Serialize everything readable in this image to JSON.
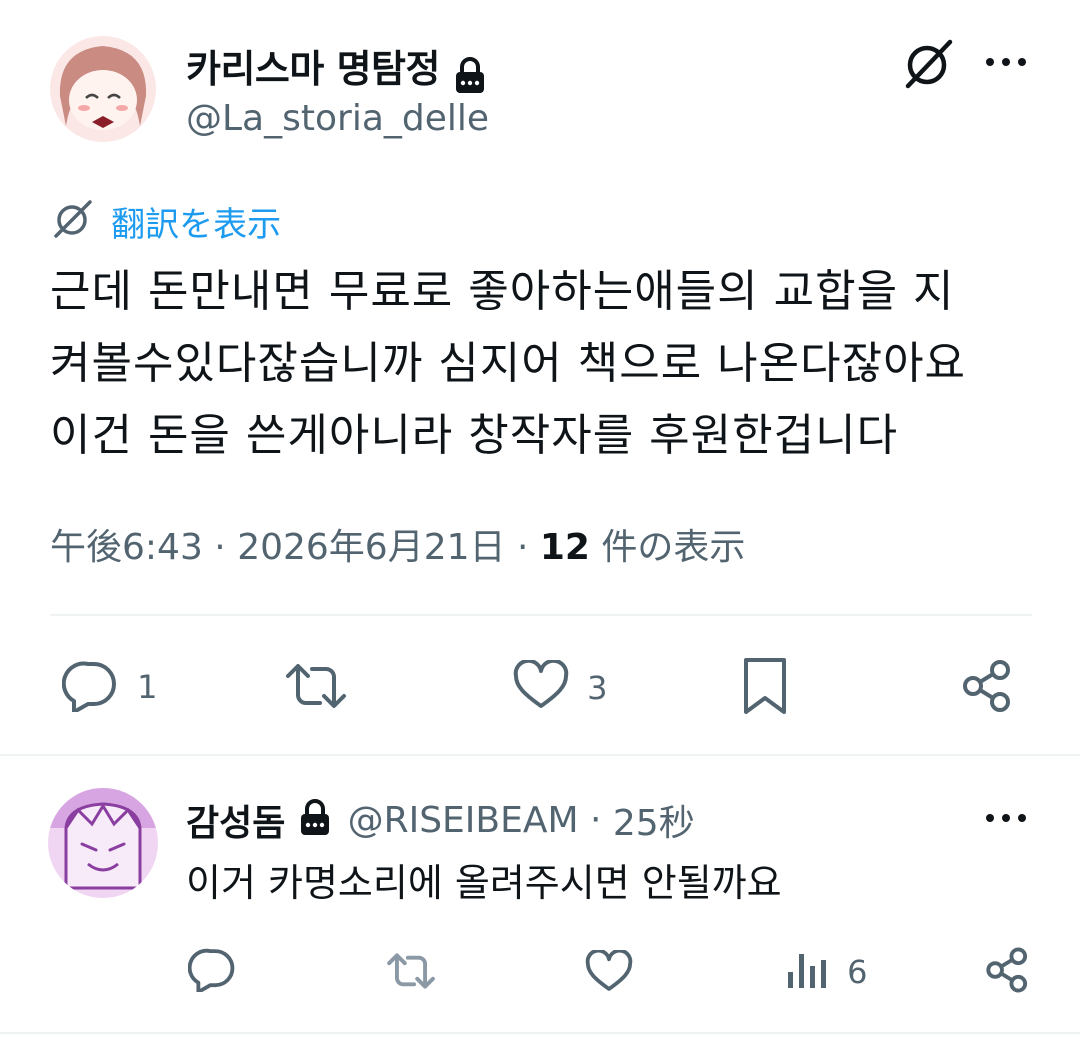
{
  "tweet": {
    "display_name": "카리스마 명탐정",
    "handle": "@La_storia_delle",
    "translate_label": "翻訳を表示",
    "text_lines": [
      "근데 돈만내면 무료로 좋아하는애들의 교합을 지",
      "켜볼수있다잖습니까 심지어 책으로 나온다잖아요",
      "이건 돈을 쓴게아니라 창작자를 후원한겁니다"
    ],
    "time": "午後6:43",
    "date": "2026年6月21日",
    "views_count": "12",
    "views_label": " 件の表示",
    "sep": " · ",
    "actions": {
      "reply_count": "1",
      "retweet_count": "",
      "like_count": "3"
    }
  },
  "reply": {
    "display_name": "감성돔",
    "handle": "@RISEIBEAM",
    "sep": " · ",
    "time": "25秒",
    "text": "이거 카명소리에 올려주시면 안될까요",
    "actions": {
      "views_count": "6"
    }
  },
  "colors": {
    "accent": "#1d9bf0",
    "muted": "#536471",
    "divider": "#eff3f4"
  },
  "icons": [
    "lock-icon",
    "grok-icon",
    "more-icon",
    "translate-icon",
    "reply-icon",
    "retweet-icon",
    "like-icon",
    "bookmark-icon",
    "share-icon",
    "views-icon"
  ]
}
